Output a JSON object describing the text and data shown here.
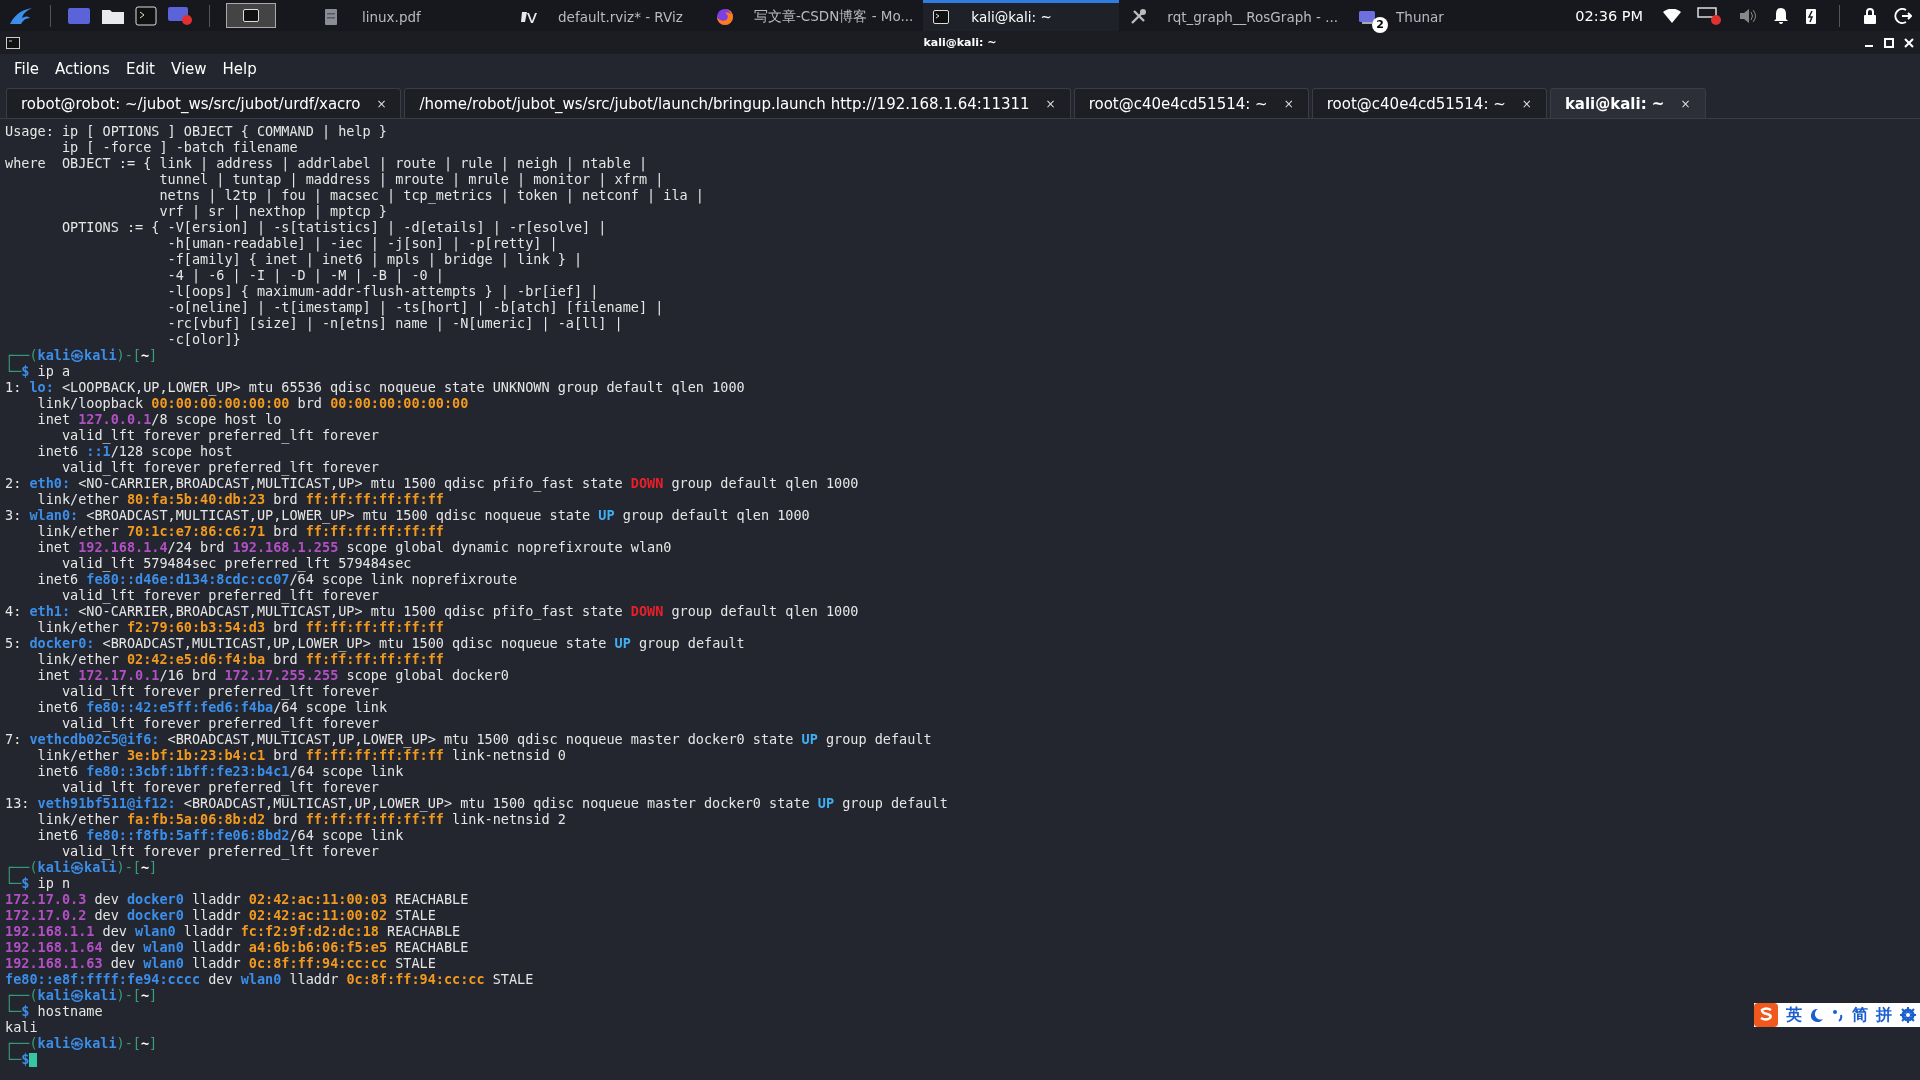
{
  "taskbar": {
    "windows": [
      {
        "kind": "pdf",
        "label": "linux.pdf",
        "selected": false
      },
      {
        "kind": "rviz",
        "label": "default.rviz* - RViz",
        "selected": false
      },
      {
        "kind": "browser",
        "label": "写文章-CSDN博客 - Mo...",
        "selected": false
      },
      {
        "kind": "terminal",
        "label": "kali@kali: ~",
        "selected": true
      },
      {
        "kind": "tools",
        "label": "rqt_graph__RosGraph - ...",
        "selected": false
      },
      {
        "kind": "files",
        "label": "Thunar",
        "selected": false,
        "badge": "2"
      }
    ],
    "clock": "02:36 PM"
  },
  "window": {
    "title": "kali@kali: ~"
  },
  "menu": [
    "File",
    "Actions",
    "Edit",
    "View",
    "Help"
  ],
  "tabs": [
    {
      "label": "robot@robot: ~/jubot_ws/src/jubot/urdf/xacro",
      "close": "×",
      "selected": false
    },
    {
      "label": "/home/robot/jubot_ws/src/jubot/launch/bringup.launch http://192.168.1.64:11311",
      "close": "×",
      "selected": false
    },
    {
      "label": "root@c40e4cd51514: ~",
      "close": "×",
      "selected": false
    },
    {
      "label": "root@c40e4cd51514: ~",
      "close": "×",
      "selected": false
    },
    {
      "label": "kali@kali: ~",
      "close": "×",
      "selected": true
    }
  ],
  "terminal": {
    "lines": [
      [
        {
          "t": "Usage: ip [ OPTIONS ] OBJECT { COMMAND | help }"
        }
      ],
      [
        {
          "t": "       ip [ -force ] -batch filename"
        }
      ],
      [
        {
          "t": "where  OBJECT := { link | address | addrlabel | route | rule | neigh | ntable |"
        }
      ],
      [
        {
          "t": "                   tunnel | tuntap | maddress | mroute | mrule | monitor | xfrm |"
        }
      ],
      [
        {
          "t": "                   netns | l2tp | fou | macsec | tcp_metrics | token | netconf | ila |"
        }
      ],
      [
        {
          "t": "                   vrf | sr | nexthop | mptcp }"
        }
      ],
      [
        {
          "t": "       OPTIONS := { -V[ersion] | -s[tatistics] | -d[etails] | -r[esolve] |"
        }
      ],
      [
        {
          "t": "                    -h[uman-readable] | -iec | -j[son] | -p[retty] |"
        }
      ],
      [
        {
          "t": "                    -f[amily] { inet | inet6 | mpls | bridge | link } |"
        }
      ],
      [
        {
          "t": "                    -4 | -6 | -I | -D | -M | -B | -0 |"
        }
      ],
      [
        {
          "t": "                    -l[oops] { maximum-addr-flush-attempts } | -br[ief] |"
        }
      ],
      [
        {
          "t": "                    -o[neline] | -t[imestamp] | -ts[hort] | -b[atch] [filename] |"
        }
      ],
      [
        {
          "t": "                    -rc[vbuf] [size] | -n[etns] name | -N[umeric] | -a[ll] |"
        }
      ],
      [
        {
          "t": "                    -c[olor]}"
        }
      ],
      [
        {
          "t": "┌──(",
          "kind": "frame"
        },
        {
          "t": "kali㉿kali",
          "kind": "host"
        },
        {
          "t": ")-[",
          "kind": "frame"
        },
        {
          "t": "~",
          "kind": "dir"
        },
        {
          "t": "]",
          "kind": "frame"
        }
      ],
      [
        {
          "t": "└─",
          "kind": "frame"
        },
        {
          "t": "$",
          "kind": "dollar"
        },
        {
          "t": " ip a"
        }
      ],
      [
        {
          "t": "1: "
        },
        {
          "t": "lo:",
          "kind": "iface"
        },
        {
          "t": " <LOOPBACK,UP,LOWER_UP> mtu 65536 qdisc noqueue state UNKNOWN group default qlen 1000"
        }
      ],
      [
        {
          "t": "    link/loopback "
        },
        {
          "t": "00:00:00:00:00:00",
          "kind": "mac"
        },
        {
          "t": " brd "
        },
        {
          "t": "00:00:00:00:00:00",
          "kind": "mac"
        }
      ],
      [
        {
          "t": "    inet "
        },
        {
          "t": "127.0.0.1",
          "kind": "addr"
        },
        {
          "t": "/8 scope host lo"
        }
      ],
      [
        {
          "t": "       valid_lft forever preferred_lft forever"
        }
      ],
      [
        {
          "t": "    inet6 "
        },
        {
          "t": "::1",
          "kind": "addr6"
        },
        {
          "t": "/128 scope host"
        }
      ],
      [
        {
          "t": "       valid_lft forever preferred_lft forever"
        }
      ],
      [
        {
          "t": "2: "
        },
        {
          "t": "eth0:",
          "kind": "iface"
        },
        {
          "t": " <NO-CARRIER,BROADCAST,MULTICAST,UP> mtu 1500 qdisc pfifo_fast state "
        },
        {
          "t": "DOWN",
          "kind": "down"
        },
        {
          "t": " group default qlen 1000"
        }
      ],
      [
        {
          "t": "    link/ether "
        },
        {
          "t": "80:fa:5b:40:db:23",
          "kind": "mac"
        },
        {
          "t": " brd "
        },
        {
          "t": "ff:ff:ff:ff:ff:ff",
          "kind": "mac"
        }
      ],
      [
        {
          "t": "3: "
        },
        {
          "t": "wlan0:",
          "kind": "iface"
        },
        {
          "t": " <BROADCAST,MULTICAST,UP,LOWER_UP> mtu 1500 qdisc noqueue state "
        },
        {
          "t": "UP",
          "kind": "up"
        },
        {
          "t": " group default qlen 1000"
        }
      ],
      [
        {
          "t": "    link/ether "
        },
        {
          "t": "70:1c:e7:86:c6:71",
          "kind": "mac"
        },
        {
          "t": " brd "
        },
        {
          "t": "ff:ff:ff:ff:ff:ff",
          "kind": "mac"
        }
      ],
      [
        {
          "t": "    inet "
        },
        {
          "t": "192.168.1.4",
          "kind": "addr"
        },
        {
          "t": "/24 brd "
        },
        {
          "t": "192.168.1.255",
          "kind": "addr"
        },
        {
          "t": " scope global dynamic noprefixroute wlan0"
        }
      ],
      [
        {
          "t": "       valid_lft 579484sec preferred_lft 579484sec"
        }
      ],
      [
        {
          "t": "    inet6 "
        },
        {
          "t": "fe80::d46e:d134:8cdc:cc07",
          "kind": "addr6"
        },
        {
          "t": "/64 scope link noprefixroute"
        }
      ],
      [
        {
          "t": "       valid_lft forever preferred_lft forever"
        }
      ],
      [
        {
          "t": "4: "
        },
        {
          "t": "eth1:",
          "kind": "iface"
        },
        {
          "t": " <NO-CARRIER,BROADCAST,MULTICAST,UP> mtu 1500 qdisc pfifo_fast state "
        },
        {
          "t": "DOWN",
          "kind": "down"
        },
        {
          "t": " group default qlen 1000"
        }
      ],
      [
        {
          "t": "    link/ether "
        },
        {
          "t": "f2:79:60:b3:54:d3",
          "kind": "mac"
        },
        {
          "t": " brd "
        },
        {
          "t": "ff:ff:ff:ff:ff:ff",
          "kind": "mac"
        }
      ],
      [
        {
          "t": "5: "
        },
        {
          "t": "docker0:",
          "kind": "iface"
        },
        {
          "t": " <BROADCAST,MULTICAST,UP,LOWER_UP> mtu 1500 qdisc noqueue state "
        },
        {
          "t": "UP",
          "kind": "up"
        },
        {
          "t": " group default"
        }
      ],
      [
        {
          "t": "    link/ether "
        },
        {
          "t": "02:42:e5:d6:f4:ba",
          "kind": "mac"
        },
        {
          "t": " brd "
        },
        {
          "t": "ff:ff:ff:ff:ff:ff",
          "kind": "mac"
        }
      ],
      [
        {
          "t": "    inet "
        },
        {
          "t": "172.17.0.1",
          "kind": "addr"
        },
        {
          "t": "/16 brd "
        },
        {
          "t": "172.17.255.255",
          "kind": "addr"
        },
        {
          "t": " scope global docker0"
        }
      ],
      [
        {
          "t": "       valid_lft forever preferred_lft forever"
        }
      ],
      [
        {
          "t": "    inet6 "
        },
        {
          "t": "fe80::42:e5ff:fed6:f4ba",
          "kind": "addr6"
        },
        {
          "t": "/64 scope link"
        }
      ],
      [
        {
          "t": "       valid_lft forever preferred_lft forever"
        }
      ],
      [
        {
          "t": "7: "
        },
        {
          "t": "vethcdb02c5@if6:",
          "kind": "iface"
        },
        {
          "t": " <BROADCAST,MULTICAST,UP,LOWER_UP> mtu 1500 qdisc noqueue master docker0 state "
        },
        {
          "t": "UP",
          "kind": "up"
        },
        {
          "t": " group default"
        }
      ],
      [
        {
          "t": "    link/ether "
        },
        {
          "t": "3e:bf:1b:23:b4:c1",
          "kind": "mac"
        },
        {
          "t": " brd "
        },
        {
          "t": "ff:ff:ff:ff:ff:ff",
          "kind": "mac"
        },
        {
          "t": " link-netnsid 0"
        }
      ],
      [
        {
          "t": "    inet6 "
        },
        {
          "t": "fe80::3cbf:1bff:fe23:b4c1",
          "kind": "addr6"
        },
        {
          "t": "/64 scope link"
        }
      ],
      [
        {
          "t": "       valid_lft forever preferred_lft forever"
        }
      ],
      [
        {
          "t": "13: "
        },
        {
          "t": "veth91bf511@if12:",
          "kind": "iface"
        },
        {
          "t": " <BROADCAST,MULTICAST,UP,LOWER_UP> mtu 1500 qdisc noqueue master docker0 state "
        },
        {
          "t": "UP",
          "kind": "up"
        },
        {
          "t": " group default"
        }
      ],
      [
        {
          "t": "    link/ether "
        },
        {
          "t": "fa:fb:5a:06:8b:d2",
          "kind": "mac"
        },
        {
          "t": " brd "
        },
        {
          "t": "ff:ff:ff:ff:ff:ff",
          "kind": "mac"
        },
        {
          "t": " link-netnsid 2"
        }
      ],
      [
        {
          "t": "    inet6 "
        },
        {
          "t": "fe80::f8fb:5aff:fe06:8bd2",
          "kind": "addr6"
        },
        {
          "t": "/64 scope link"
        }
      ],
      [
        {
          "t": "       valid_lft forever preferred_lft forever"
        }
      ],
      [
        {
          "t": "┌──(",
          "kind": "frame"
        },
        {
          "t": "kali㉿kali",
          "kind": "host"
        },
        {
          "t": ")-[",
          "kind": "frame"
        },
        {
          "t": "~",
          "kind": "dir"
        },
        {
          "t": "]",
          "kind": "frame"
        }
      ],
      [
        {
          "t": "└─",
          "kind": "frame"
        },
        {
          "t": "$",
          "kind": "dollar"
        },
        {
          "t": " ip n"
        }
      ],
      [
        {
          "t": "172.17.0.3",
          "kind": "addr"
        },
        {
          "t": " dev "
        },
        {
          "t": "docker0",
          "kind": "iface"
        },
        {
          "t": " lladdr "
        },
        {
          "t": "02:42:ac:11:00:03",
          "kind": "mac"
        },
        {
          "t": " REACHABLE"
        }
      ],
      [
        {
          "t": "172.17.0.2",
          "kind": "addr"
        },
        {
          "t": " dev "
        },
        {
          "t": "docker0",
          "kind": "iface"
        },
        {
          "t": " lladdr "
        },
        {
          "t": "02:42:ac:11:00:02",
          "kind": "mac"
        },
        {
          "t": " STALE"
        }
      ],
      [
        {
          "t": "192.168.1.1",
          "kind": "addr"
        },
        {
          "t": " dev "
        },
        {
          "t": "wlan0",
          "kind": "iface"
        },
        {
          "t": " lladdr "
        },
        {
          "t": "fc:f2:9f:d2:dc:18",
          "kind": "mac"
        },
        {
          "t": " REACHABLE"
        }
      ],
      [
        {
          "t": "192.168.1.64",
          "kind": "addr"
        },
        {
          "t": " dev "
        },
        {
          "t": "wlan0",
          "kind": "iface"
        },
        {
          "t": " lladdr "
        },
        {
          "t": "a4:6b:b6:06:f5:e5",
          "kind": "mac"
        },
        {
          "t": " REACHABLE"
        }
      ],
      [
        {
          "t": "192.168.1.63",
          "kind": "addr"
        },
        {
          "t": " dev "
        },
        {
          "t": "wlan0",
          "kind": "iface"
        },
        {
          "t": " lladdr "
        },
        {
          "t": "0c:8f:ff:94:cc:cc",
          "kind": "mac"
        },
        {
          "t": " STALE"
        }
      ],
      [
        {
          "t": "fe80::e8f:ffff:fe94:cccc",
          "kind": "addr6"
        },
        {
          "t": " dev "
        },
        {
          "t": "wlan0",
          "kind": "iface"
        },
        {
          "t": " lladdr "
        },
        {
          "t": "0c:8f:ff:94:cc:cc",
          "kind": "mac"
        },
        {
          "t": " STALE"
        }
      ],
      [
        {
          "t": "┌──(",
          "kind": "frame"
        },
        {
          "t": "kali㉿kali",
          "kind": "host"
        },
        {
          "t": ")-[",
          "kind": "frame"
        },
        {
          "t": "~",
          "kind": "dir"
        },
        {
          "t": "]",
          "kind": "frame"
        }
      ],
      [
        {
          "t": "└─",
          "kind": "frame"
        },
        {
          "t": "$",
          "kind": "dollar"
        },
        {
          "t": " hostname"
        }
      ],
      [
        {
          "t": "kali"
        }
      ],
      [
        {
          "t": "┌──(",
          "kind": "frame"
        },
        {
          "t": "kali㉿kali",
          "kind": "host"
        },
        {
          "t": ")-[",
          "kind": "frame"
        },
        {
          "t": "~",
          "kind": "dir"
        },
        {
          "t": "]",
          "kind": "frame"
        }
      ],
      [
        {
          "t": "└─",
          "kind": "frame"
        },
        {
          "t": "$",
          "kind": "dollar"
        }
      ]
    ]
  },
  "ime": {
    "labels": [
      "英",
      "简",
      "拼"
    ]
  }
}
